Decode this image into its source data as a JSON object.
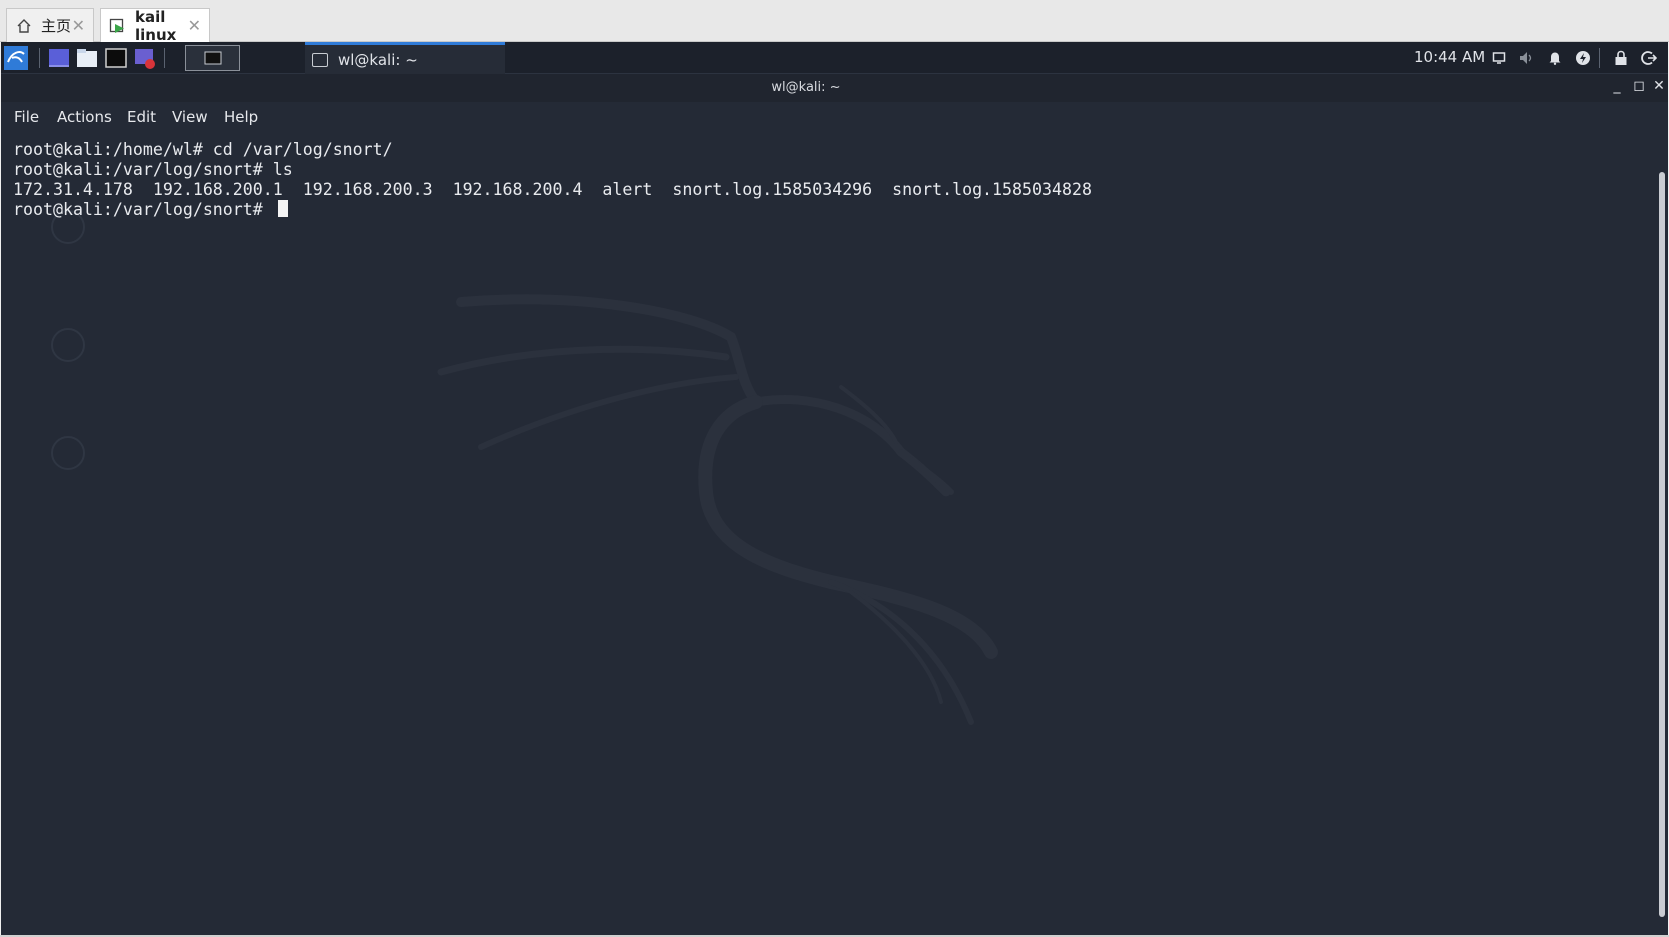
{
  "host_tabs": [
    {
      "label": "主页",
      "icon": "home-icon",
      "active": false
    },
    {
      "label": "kail linux",
      "icon": "vm-icon",
      "active": true
    }
  ],
  "panel": {
    "launchers": [
      "kali-menu-icon",
      "desktop-icon",
      "file-manager-icon",
      "terminal-icon",
      "screen-recorder-icon"
    ],
    "task_title": "wl@kali: ~",
    "clock": "10:44 AM",
    "tray_icons": [
      "display-icon",
      "volume-icon",
      "notification-bell-icon",
      "power-manager-icon",
      "lock-icon",
      "logout-icon"
    ]
  },
  "terminal_window": {
    "title": "wl@kali: ~",
    "controls": {
      "minimize": "_",
      "maximize": "◻",
      "close": "✕"
    },
    "menu": [
      "File",
      "Actions",
      "Edit",
      "View",
      "Help"
    ],
    "lines": [
      "root@kali:/home/wl# cd /var/log/snort/",
      "root@kali:/var/log/snort# ls",
      "172.31.4.178  192.168.200.1  192.168.200.3  192.168.200.4  alert  snort.log.1585034296  snort.log.1585034828",
      "root@kali:/var/log/snort# "
    ]
  },
  "colors": {
    "terminal_bg": "#242a36",
    "panel_bg": "#1c212b",
    "accent": "#2f7bd8",
    "text": "#e8eaee"
  }
}
